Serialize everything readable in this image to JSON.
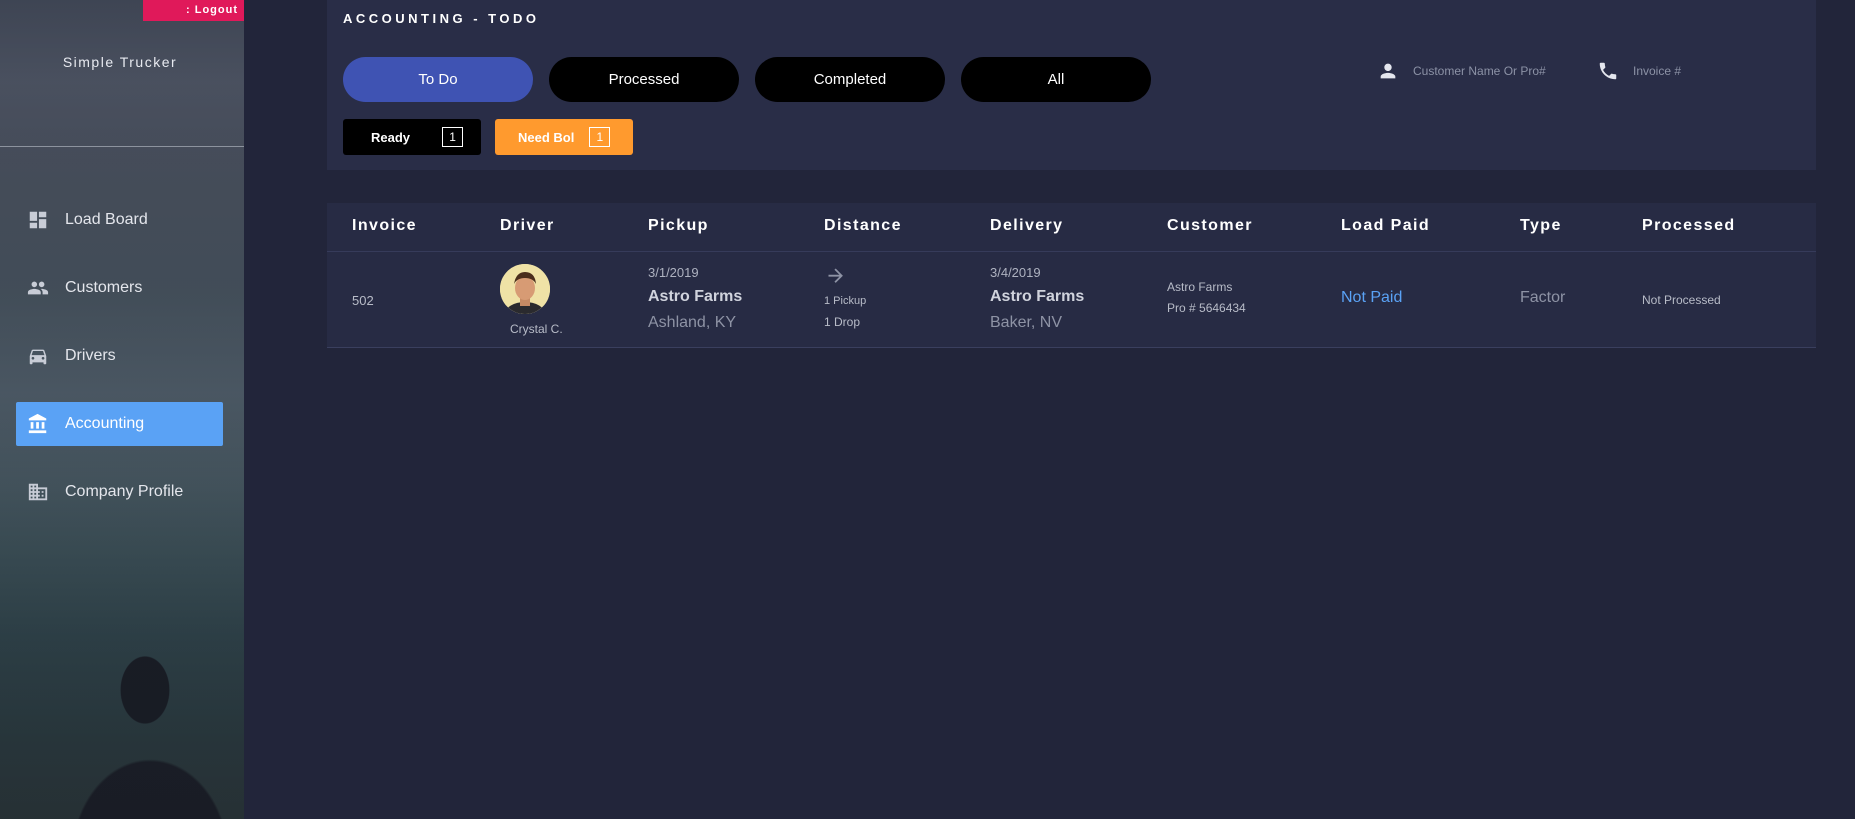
{
  "sidebar": {
    "logout_label": ": Logout",
    "brand": "Simple Trucker",
    "items": [
      {
        "label": "Load Board",
        "icon": "dashboard-icon"
      },
      {
        "label": "Customers",
        "icon": "people-icon"
      },
      {
        "label": "Drivers",
        "icon": "car-icon"
      },
      {
        "label": "Accounting",
        "icon": "bank-icon",
        "active": true
      },
      {
        "label": "Company Profile",
        "icon": "building-icon"
      }
    ]
  },
  "header": {
    "title": "ACCOUNTING - TODO",
    "tabs": [
      {
        "label": "To Do",
        "active": true
      },
      {
        "label": "Processed"
      },
      {
        "label": "Completed"
      },
      {
        "label": "All"
      }
    ],
    "filters": [
      {
        "label": "Ready",
        "count": "1"
      },
      {
        "label": "Need Bol",
        "count": "1"
      }
    ],
    "search": {
      "customer_placeholder": "Customer Name Or Pro#",
      "invoice_placeholder": "Invoice #"
    }
  },
  "table": {
    "columns": [
      "Invoice",
      "Driver",
      "Pickup",
      "Distance",
      "Delivery",
      "Customer",
      "Load Paid",
      "Type",
      "Processed"
    ],
    "rows": [
      {
        "invoice": "502",
        "driver": "Crystal C.",
        "pickup": {
          "date": "3/1/2019",
          "name": "Astro Farms",
          "city": "Ashland, KY"
        },
        "distance": {
          "pickups": "1 Pickup",
          "drops": "1 Drop"
        },
        "delivery": {
          "date": "3/4/2019",
          "name": "Astro Farms",
          "city": "Baker, NV"
        },
        "customer": {
          "name": "Astro Farms",
          "pro": "Pro # 5646434"
        },
        "load_paid": "Not Paid",
        "type": "Factor",
        "processed": "Not Processed"
      }
    ]
  },
  "colors": {
    "accent_blue": "#5aa2f5",
    "tab_active": "#3f53b3",
    "logout": "#e0195a",
    "need_bol": "#ff9a2e",
    "background": "#22253a",
    "panel": "#292d47"
  }
}
